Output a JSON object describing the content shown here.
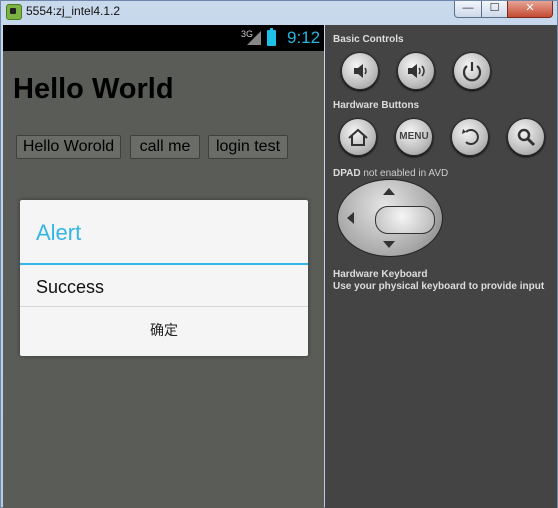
{
  "window": {
    "title": "5554:zj_intel4.1.2",
    "close_label": "✕",
    "minimize_label": "—",
    "maximize_label": "☐"
  },
  "statusbar": {
    "network": "3G",
    "time": "9:12"
  },
  "app": {
    "title": "Hello World",
    "buttons": [
      "Hello Worold",
      "call me",
      "login test"
    ]
  },
  "dialog": {
    "title": "Alert",
    "message": "Success",
    "button": "确定"
  },
  "panel": {
    "basic_controls": "Basic Controls",
    "hardware_buttons": "Hardware Buttons",
    "dpad_label": "DPAD",
    "dpad_note": "not enabled in AVD",
    "hardware_keyboard": "Hardware Keyboard",
    "keyboard_note": "Use your physical keyboard to provide input",
    "menu_label": "MENU",
    "icons": [
      "volume-down-icon",
      "volume-up-icon",
      "power-icon",
      "home-icon",
      "menu-button",
      "back-icon",
      "search-icon"
    ]
  },
  "colors": {
    "accent": "#33b5e5",
    "panel": "#444444",
    "screen": "#5a5c58"
  }
}
